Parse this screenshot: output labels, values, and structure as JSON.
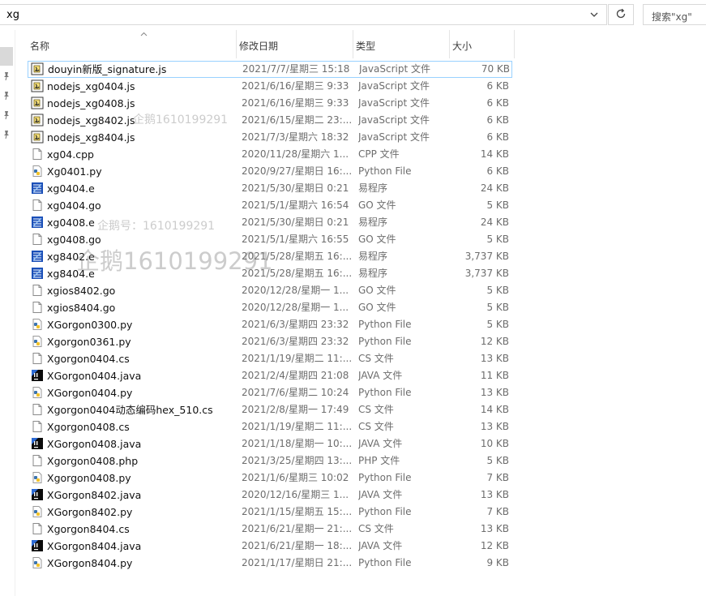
{
  "address": {
    "path": "xg"
  },
  "search": {
    "placeholder": "搜索\"xg\""
  },
  "columns": {
    "name": "名称",
    "date": "修改日期",
    "type": "类型",
    "size": "大小"
  },
  "watermarks": {
    "small_1": "企鹅1610199291",
    "small_2": "企鹅号：1610199291",
    "large": "企鹅1610199291"
  },
  "files": [
    {
      "name": "douyin新版_signature.js",
      "date": "2021/7/7/星期三 15:18",
      "type": "JavaScript 文件",
      "size": "70 KB",
      "icon": "js-file-icon",
      "selected": true
    },
    {
      "name": "nodejs_xg0404.js",
      "date": "2021/6/16/星期三 9:33",
      "type": "JavaScript 文件",
      "size": "6 KB",
      "icon": "js-file-icon"
    },
    {
      "name": "nodejs_xg0408.js",
      "date": "2021/6/16/星期三 9:33",
      "type": "JavaScript 文件",
      "size": "6 KB",
      "icon": "js-file-icon"
    },
    {
      "name": "nodejs_xg8402.js",
      "date": "2021/6/15/星期二 23:...",
      "type": "JavaScript 文件",
      "size": "6 KB",
      "icon": "js-file-icon"
    },
    {
      "name": "nodejs_xg8404.js",
      "date": "2021/7/3/星期六 18:32",
      "type": "JavaScript 文件",
      "size": "6 KB",
      "icon": "js-file-icon"
    },
    {
      "name": "xg04.cpp",
      "date": "2020/11/28/星期六 1...",
      "type": "CPP 文件",
      "size": "14 KB",
      "icon": "blank-file-icon"
    },
    {
      "name": "Xg0401.py",
      "date": "2020/9/27/星期日 16:...",
      "type": "Python File",
      "size": "6 KB",
      "icon": "python-file-icon"
    },
    {
      "name": "xg0404.e",
      "date": "2021/5/30/星期日 0:21",
      "type": "易程序",
      "size": "24 KB",
      "icon": "e-file-icon"
    },
    {
      "name": "xg0404.go",
      "date": "2021/5/1/星期六 16:54",
      "type": "GO 文件",
      "size": "5 KB",
      "icon": "blank-file-icon"
    },
    {
      "name": "xg0408.e",
      "date": "2021/5/30/星期日 0:21",
      "type": "易程序",
      "size": "24 KB",
      "icon": "e-file-icon"
    },
    {
      "name": "xg0408.go",
      "date": "2021/5/1/星期六 16:55",
      "type": "GO 文件",
      "size": "5 KB",
      "icon": "blank-file-icon"
    },
    {
      "name": "xg8402.e",
      "date": "2021/5/28/星期五 16:...",
      "type": "易程序",
      "size": "3,737 KB",
      "icon": "e-file-icon"
    },
    {
      "name": "xg8404.e",
      "date": "2021/5/28/星期五 16:...",
      "type": "易程序",
      "size": "3,737 KB",
      "icon": "e-file-icon"
    },
    {
      "name": "xgios8402.go",
      "date": "2020/12/28/星期一 1...",
      "type": "GO 文件",
      "size": "5 KB",
      "icon": "blank-file-icon"
    },
    {
      "name": "xgios8404.go",
      "date": "2020/12/28/星期一 1...",
      "type": "GO 文件",
      "size": "5 KB",
      "icon": "blank-file-icon"
    },
    {
      "name": "XGorgon0300.py",
      "date": "2021/6/3/星期四 23:32",
      "type": "Python File",
      "size": "5 KB",
      "icon": "python-file-icon"
    },
    {
      "name": "Xgorgon0361.py",
      "date": "2021/6/3/星期四 23:32",
      "type": "Python File",
      "size": "12 KB",
      "icon": "python-file-icon"
    },
    {
      "name": "Xgorgon0404.cs",
      "date": "2021/1/19/星期二 11:...",
      "type": "CS 文件",
      "size": "13 KB",
      "icon": "blank-file-icon"
    },
    {
      "name": "XGorgon0404.java",
      "date": "2021/2/4/星期四 21:08",
      "type": "JAVA 文件",
      "size": "11 KB",
      "icon": "java-file-icon"
    },
    {
      "name": "XGorgon0404.py",
      "date": "2021/7/6/星期二 10:24",
      "type": "Python File",
      "size": "13 KB",
      "icon": "python-file-icon"
    },
    {
      "name": "Xgorgon0404动态编码hex_510.cs",
      "date": "2021/2/8/星期一 17:49",
      "type": "CS 文件",
      "size": "14 KB",
      "icon": "blank-file-icon"
    },
    {
      "name": "Xgorgon0408.cs",
      "date": "2021/1/19/星期二 11:...",
      "type": "CS 文件",
      "size": "13 KB",
      "icon": "blank-file-icon"
    },
    {
      "name": "XGorgon0408.java",
      "date": "2021/1/18/星期一 10:...",
      "type": "JAVA 文件",
      "size": "10 KB",
      "icon": "java-file-icon"
    },
    {
      "name": "Xgorgon0408.php",
      "date": "2021/3/25/星期四 13:...",
      "type": "PHP 文件",
      "size": "5 KB",
      "icon": "blank-file-icon"
    },
    {
      "name": "Xgorgon0408.py",
      "date": "2021/1/6/星期三 10:02",
      "type": "Python File",
      "size": "7 KB",
      "icon": "python-file-icon"
    },
    {
      "name": "XGorgon8402.java",
      "date": "2020/12/16/星期三 1...",
      "type": "JAVA 文件",
      "size": "13 KB",
      "icon": "java-file-icon"
    },
    {
      "name": "XGorgon8402.py",
      "date": "2021/1/15/星期五 15:...",
      "type": "Python File",
      "size": "7 KB",
      "icon": "python-file-icon"
    },
    {
      "name": "Xgorgon8404.cs",
      "date": "2021/6/21/星期一 21:...",
      "type": "CS 文件",
      "size": "13 KB",
      "icon": "blank-file-icon"
    },
    {
      "name": "XGorgon8404.java",
      "date": "2021/6/21/星期一 18:...",
      "type": "JAVA 文件",
      "size": "12 KB",
      "icon": "java-file-icon"
    },
    {
      "name": "XGorgon8404.py",
      "date": "2021/1/17/星期日 21:...",
      "type": "Python File",
      "size": "9 KB",
      "icon": "python-file-icon"
    }
  ]
}
